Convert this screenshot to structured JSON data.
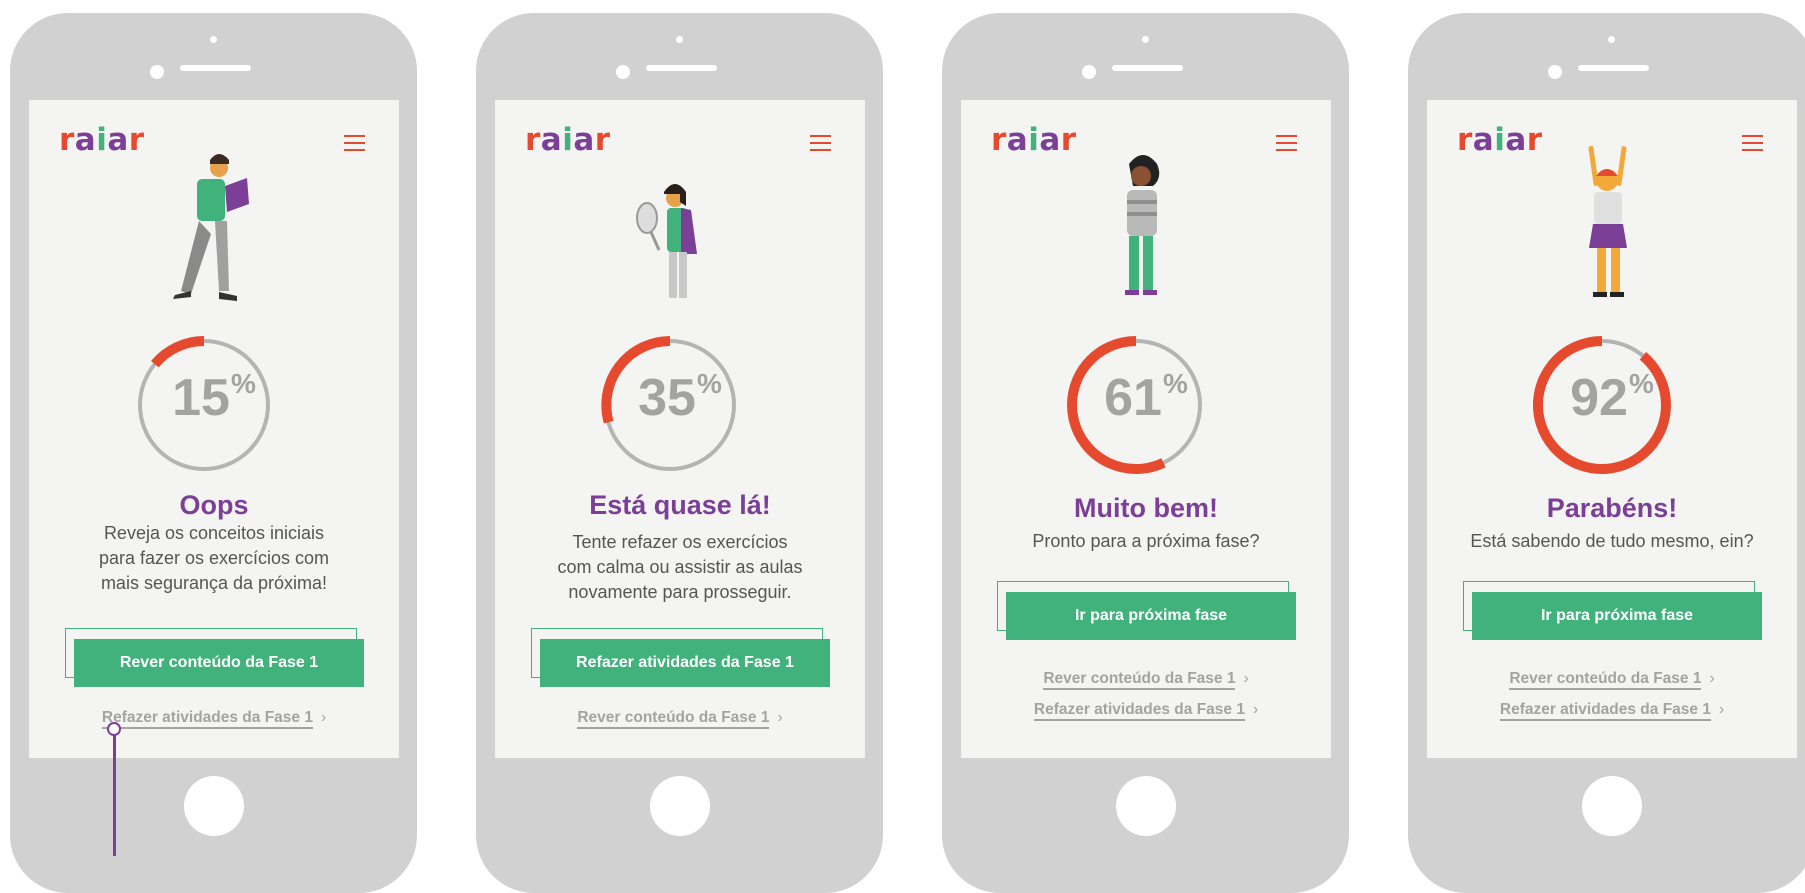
{
  "brand": {
    "logo_parts": [
      "r",
      "a",
      "i",
      "a",
      "r"
    ],
    "colors": {
      "purple": "#7b3f98",
      "orange": "#e64a2e",
      "green": "#41b27b",
      "gray": "#a3a3a3"
    }
  },
  "icons": {
    "menu": "hamburger-icon",
    "chevron": "chevron-right-icon"
  },
  "screens": [
    {
      "percent": "15",
      "percent_symbol": "%",
      "progress": 0.15,
      "title": "Oops",
      "desc": [
        "Reveja os conceitos iniciais",
        "para fazer os exercícios com",
        "mais segurança da próxima!"
      ],
      "button": "Rever conteúdo da Fase 1",
      "links": [
        "Refazer atividades da Fase 1"
      ]
    },
    {
      "percent": "35",
      "percent_symbol": "%",
      "progress": 0.35,
      "title": "Está quase lá!",
      "desc": [
        "Tente refazer os exercícios",
        "com calma ou assistir as aulas",
        "novamente para prosseguir."
      ],
      "button": "Refazer atividades da Fase 1",
      "links": [
        "Rever conteúdo da Fase 1"
      ]
    },
    {
      "percent": "61",
      "percent_symbol": "%",
      "progress": 0.61,
      "title": "Muito bem!",
      "desc": [
        "Pronto para a próxima fase?"
      ],
      "button": "Ir para próxima fase",
      "links": [
        "Rever conteúdo da Fase 1",
        "Refazer atividades da Fase 1"
      ]
    },
    {
      "percent": "92",
      "percent_symbol": "%",
      "progress": 0.92,
      "title": "Parabéns!",
      "desc": [
        "Está sabendo de tudo mesmo, ein?"
      ],
      "button": "Ir para próxima fase",
      "links": [
        "Rever conteúdo da Fase 1",
        "Refazer atividades da Fase 1"
      ]
    }
  ]
}
